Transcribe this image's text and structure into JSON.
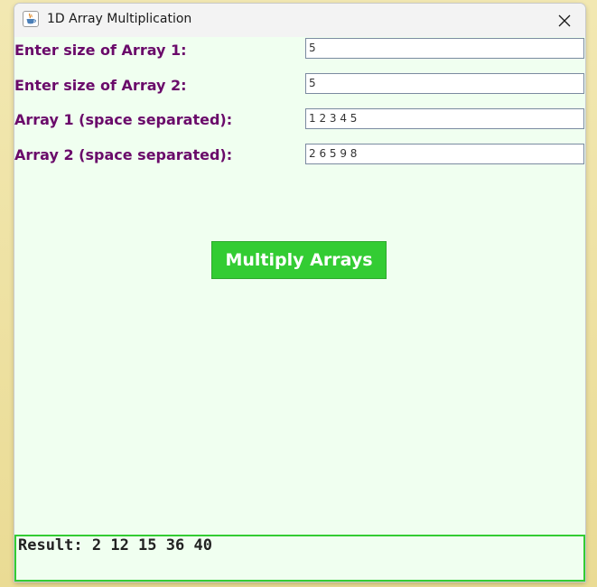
{
  "window": {
    "title": "1D Array Multiplication",
    "icon": "java-cup-icon"
  },
  "form": {
    "size1_label": "Enter size of Array 1:",
    "size1_value": "5",
    "size2_label": "Enter size of Array 2:",
    "size2_value": "5",
    "array1_label": "Array 1 (space separated):",
    "array1_value": "1 2 3 4 5",
    "array2_label": "Array 2 (space separated):",
    "array2_value": "2 6 5 9 8"
  },
  "actions": {
    "multiply_label": "Multiply Arrays"
  },
  "result": {
    "text": "Result: 2 12 15 36 40"
  },
  "colors": {
    "window_background": "#f0fff0",
    "label_color": "#6a0a6a",
    "button_color": "#33cc33",
    "result_border": "#33cc33"
  }
}
